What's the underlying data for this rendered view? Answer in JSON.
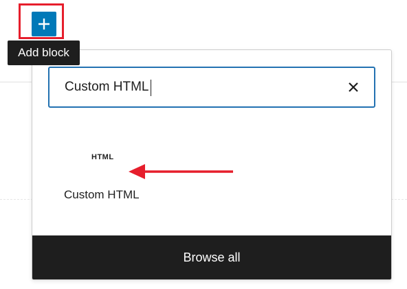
{
  "toolbar": {
    "add_block_tooltip": "Add block",
    "add_icon": "plus-icon"
  },
  "inserter": {
    "search": {
      "value": "Custom HTML",
      "clear_icon": "close-icon"
    },
    "results": [
      {
        "icon_text": "HTML",
        "label": "Custom HTML"
      }
    ],
    "browse_all_label": "Browse all"
  },
  "colors": {
    "accent": "#2271b1",
    "add_button": "#0079b8",
    "highlight": "#e61e2c",
    "dark": "#1e1e1e"
  }
}
